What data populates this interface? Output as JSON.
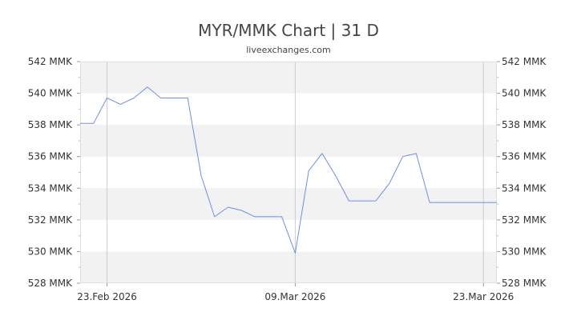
{
  "header": {
    "title": "MYR/MMK Chart | 31 D",
    "source": "liveexchanges.com"
  },
  "chart_data": {
    "type": "line",
    "title": "MYR/MMK Chart | 31 D",
    "xlabel": "",
    "ylabel": "",
    "ylim": [
      528,
      542
    ],
    "y_ticks": [
      528,
      530,
      532,
      534,
      536,
      538,
      540,
      542
    ],
    "y_tick_labels": [
      "528 MMK",
      "530 MMK",
      "532 MMK",
      "534 MMK",
      "536 MMK",
      "538 MMK",
      "540 MMK",
      "542 MMK"
    ],
    "x_ticks": [
      "2026-02-23",
      "2026-03-09",
      "2026-03-23"
    ],
    "x_tick_labels": [
      "23.Feb 2026",
      "09.Mar 2026",
      "23.Mar 2026"
    ],
    "grid": "alternating horizontal bands",
    "line_color": "#6f8fdc",
    "series": [
      {
        "x": [
          "2026-02-21",
          "2026-02-22",
          "2026-02-23",
          "2026-02-24",
          "2026-02-25",
          "2026-02-26",
          "2026-02-27",
          "2026-02-28",
          "2026-03-01",
          "2026-03-02",
          "2026-03-03",
          "2026-03-04",
          "2026-03-05",
          "2026-03-06",
          "2026-03-07",
          "2026-03-08",
          "2026-03-09",
          "2026-03-10",
          "2026-03-11",
          "2026-03-12",
          "2026-03-13",
          "2026-03-14",
          "2026-03-15",
          "2026-03-16",
          "2026-03-17",
          "2026-03-18",
          "2026-03-19",
          "2026-03-20",
          "2026-03-21",
          "2026-03-22",
          "2026-03-23",
          "2026-03-24"
        ],
        "values": [
          538.1,
          538.1,
          539.7,
          539.3,
          539.7,
          540.4,
          539.7,
          539.7,
          539.7,
          534.8,
          532.2,
          532.8,
          532.6,
          532.2,
          532.2,
          532.2,
          529.9,
          535.1,
          536.2,
          534.8,
          533.2,
          533.2,
          533.2,
          534.3,
          536.0,
          536.2,
          533.1,
          533.1,
          533.1,
          533.1,
          533.1,
          533.1
        ]
      }
    ]
  }
}
